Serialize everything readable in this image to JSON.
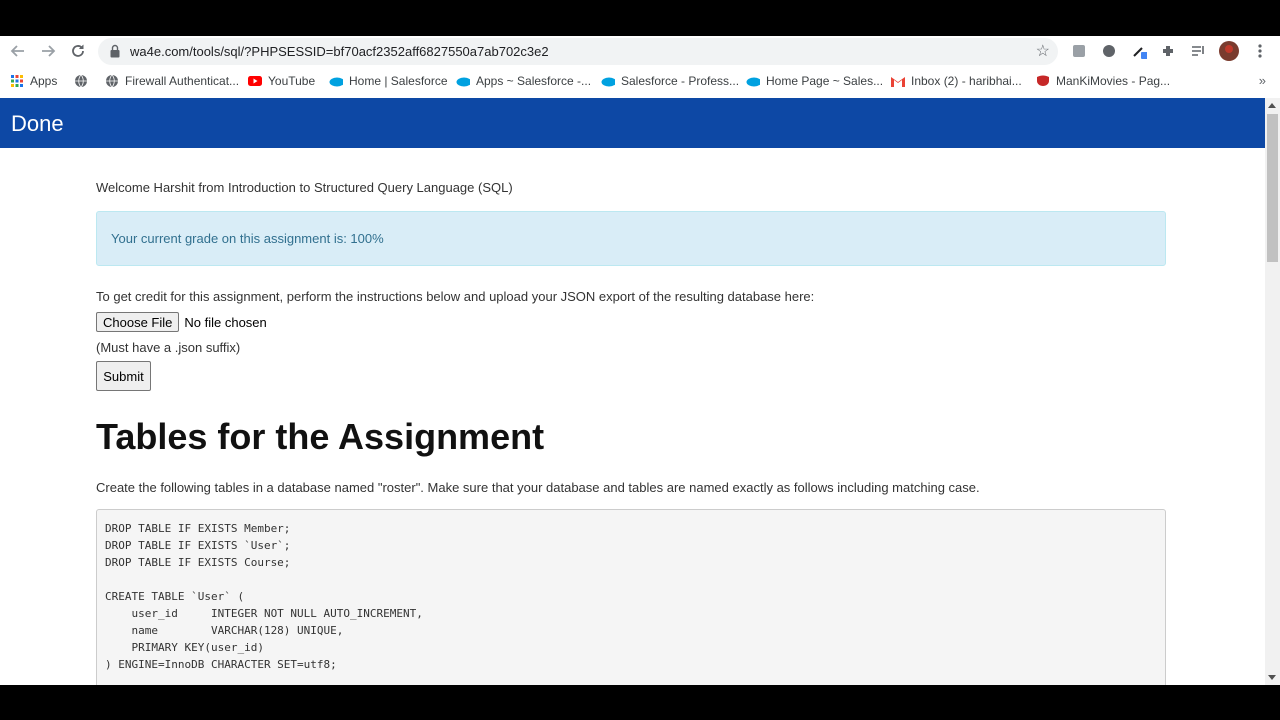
{
  "browser": {
    "url": "wa4e.com/tools/sql/?PHPSESSID=bf70acf2352aff6827550a7ab702c3e2",
    "bookmarks": [
      {
        "label": "Apps",
        "icon": "apps-grid-icon"
      },
      {
        "label": "",
        "icon": "globe-icon"
      },
      {
        "label": "Firewall Authenticat...",
        "icon": "globe-icon"
      },
      {
        "label": "YouTube",
        "icon": "youtube-icon"
      },
      {
        "label": "Home | Salesforce",
        "icon": "salesforce-icon"
      },
      {
        "label": "Apps ~ Salesforce -...",
        "icon": "salesforce-icon"
      },
      {
        "label": "Salesforce - Profess...",
        "icon": "salesforce-icon"
      },
      {
        "label": "Home Page ~ Sales...",
        "icon": "salesforce-icon"
      },
      {
        "label": "Inbox (2) - haribhai...",
        "icon": "gmail-icon"
      },
      {
        "label": "ManKiMovies - Pag...",
        "icon": "mankimovies-icon"
      }
    ],
    "colors": {
      "navbar": "#0d48a5",
      "alert_bg": "#d9edf7",
      "alert_text": "#31708f"
    }
  },
  "page": {
    "brand": "Done",
    "welcome": "Welcome Harshit from Introduction to Structured Query Language (SQL)",
    "grade": "Your current grade on this assignment is: 100%",
    "instructions": "To get credit for this assignment, perform the instructions below and upload your JSON export of the resulting database here:",
    "choose_file": "Choose File",
    "no_file": "No file chosen",
    "suffix_note": "(Must have a .json suffix)",
    "submit": "Submit",
    "heading": "Tables for the Assignment",
    "description": "Create the following tables in a database named \"roster\". Make sure that your database and tables are named exactly as follows including matching case.",
    "code": "DROP TABLE IF EXISTS Member;\nDROP TABLE IF EXISTS `User`;\nDROP TABLE IF EXISTS Course;\n\nCREATE TABLE `User` (\n    user_id     INTEGER NOT NULL AUTO_INCREMENT,\n    name        VARCHAR(128) UNIQUE,\n    PRIMARY KEY(user_id)\n) ENGINE=InnoDB CHARACTER SET=utf8;"
  }
}
